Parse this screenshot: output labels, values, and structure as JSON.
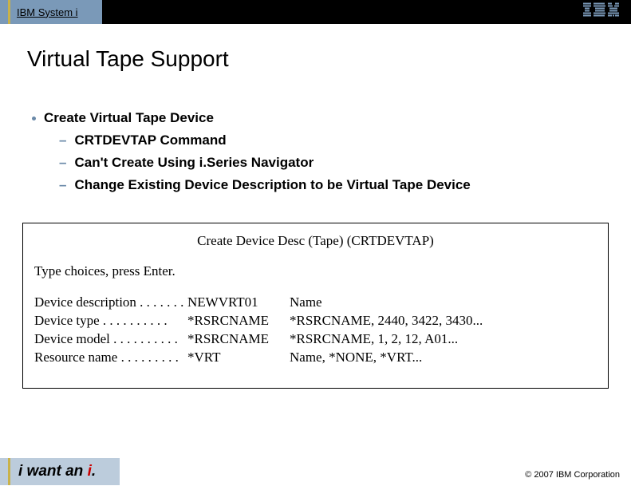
{
  "topbar": {
    "label": "IBM System i"
  },
  "title": "Virtual Tape Support",
  "bullet_main": "Create Virtual Tape Device",
  "sub_items": [
    "CRTDEVTAP Command",
    "Can't Create Using i.Series Navigator",
    "Change Existing Device Description to be Virtual Tape Device"
  ],
  "terminal": {
    "title": "Create Device Desc (Tape) (CRTDEVTAP)",
    "instruction": "Type choices, press Enter.",
    "rows": [
      {
        "label": "Device description . . . . . . .",
        "value": "NEWVRT01",
        "help": "Name"
      },
      {
        "label": "Device type  . . . . . . . . . .",
        "value": "*RSRCNAME",
        "help": "*RSRCNAME, 2440, 3422, 3430..."
      },
      {
        "label": "Device model . . . . . . . . . .",
        "value": "*RSRCNAME",
        "help": "*RSRCNAME, 1, 2, 12, A01..."
      },
      {
        "label": "Resource name  . . . . . . . . .",
        "value": "*VRT",
        "help": "Name, *NONE, *VRT..."
      }
    ]
  },
  "footer": {
    "tagline_pre": "i want an ",
    "tagline_em": "i",
    "tagline_post": ".",
    "copyright": "© 2007 IBM Corporation"
  }
}
